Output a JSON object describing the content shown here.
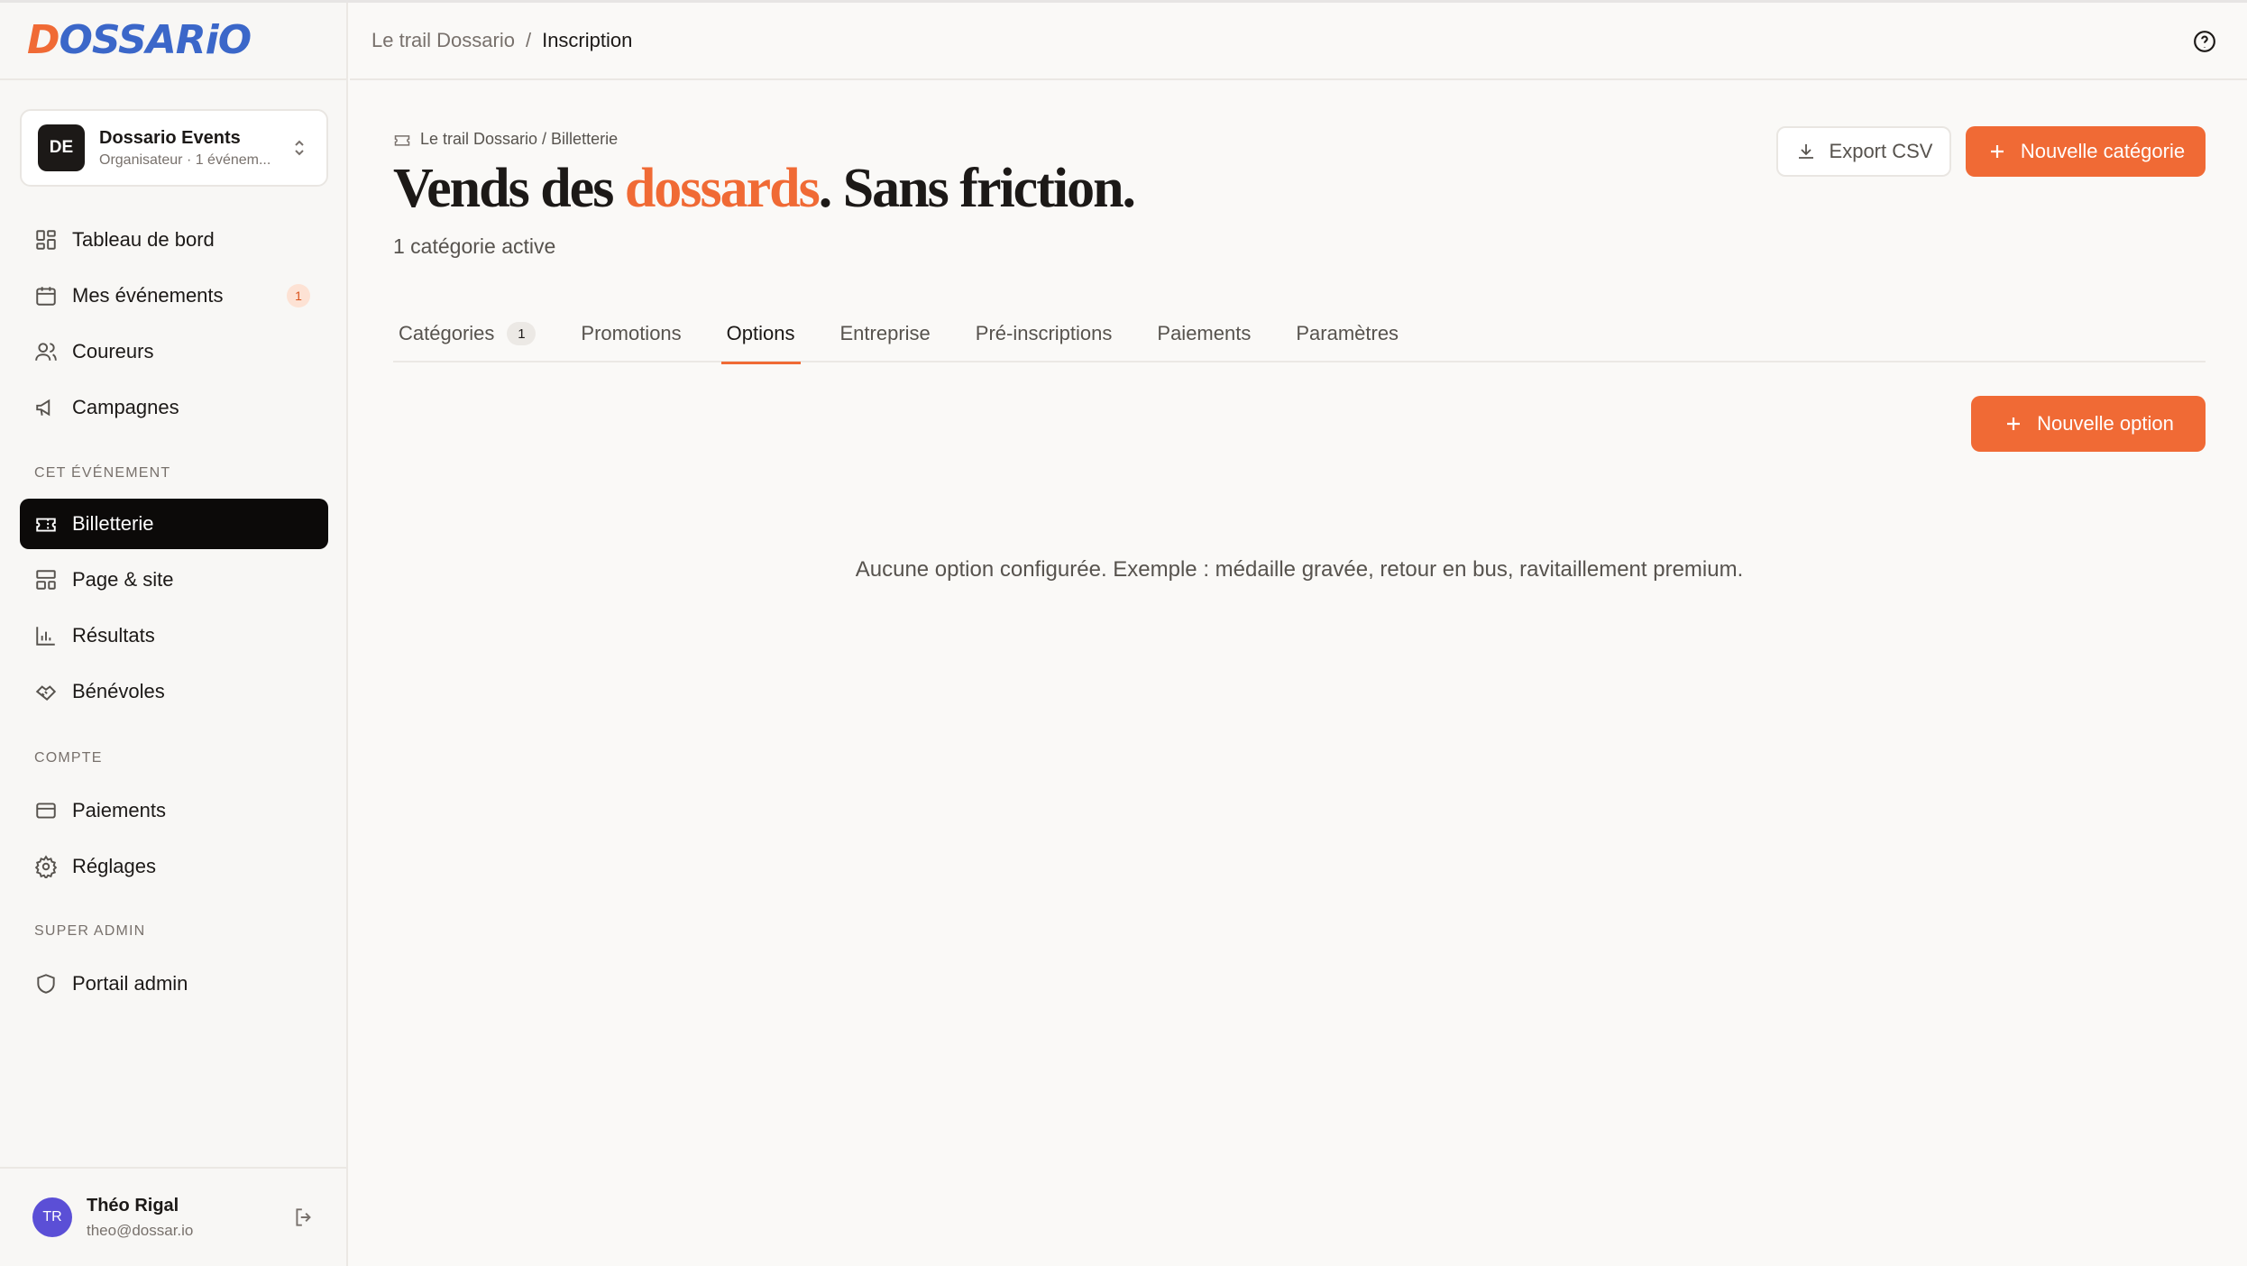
{
  "brand": {
    "logo_first": "D",
    "logo_rest": "OSSARiO",
    "accent": "#f06a35",
    "logo_blue": "#3b67c9"
  },
  "org": {
    "initials": "DE",
    "name": "Dossario Events",
    "subtitle": "Organisateur · 1 événem..."
  },
  "nav": {
    "main": [
      {
        "label": "Tableau de bord",
        "icon": "dashboard-icon"
      },
      {
        "label": "Mes événements",
        "icon": "calendar-icon",
        "badge": "1"
      },
      {
        "label": "Coureurs",
        "icon": "users-icon"
      },
      {
        "label": "Campagnes",
        "icon": "megaphone-icon"
      }
    ],
    "event_section": "CET ÉVÉNEMENT",
    "event": [
      {
        "label": "Billetterie",
        "icon": "ticket-icon",
        "active": true
      },
      {
        "label": "Page & site",
        "icon": "layout-icon"
      },
      {
        "label": "Résultats",
        "icon": "bar-chart-icon"
      },
      {
        "label": "Bénévoles",
        "icon": "handshake-icon"
      }
    ],
    "account_section": "COMPTE",
    "account": [
      {
        "label": "Paiements",
        "icon": "credit-card-icon"
      },
      {
        "label": "Réglages",
        "icon": "gear-icon"
      }
    ],
    "admin_section": "SUPER ADMIN",
    "admin": [
      {
        "label": "Portail admin",
        "icon": "shield-icon"
      }
    ]
  },
  "user": {
    "initials": "TR",
    "name": "Théo Rigal",
    "email": "theo@dossar.io"
  },
  "header": {
    "crumb": "Le trail Dossario",
    "separator": "/",
    "current": "Inscription"
  },
  "page": {
    "pre_crumb": "Le trail Dossario / Billetterie",
    "headline_start": "Vends des ",
    "headline_accent": "dossards",
    "headline_end": ". Sans friction.",
    "subline": "1 catégorie active",
    "export_label": "Export CSV",
    "new_category_label": "Nouvelle catégorie",
    "new_option_label": "Nouvelle option",
    "empty_text": "Aucune option configurée. Exemple : médaille gravée, retour en bus, ravitaillement premium."
  },
  "tabs": [
    {
      "label": "Catégories",
      "count": "1"
    },
    {
      "label": "Promotions"
    },
    {
      "label": "Options",
      "active": true
    },
    {
      "label": "Entreprise"
    },
    {
      "label": "Pré-inscriptions"
    },
    {
      "label": "Paiements"
    },
    {
      "label": "Paramètres"
    }
  ]
}
